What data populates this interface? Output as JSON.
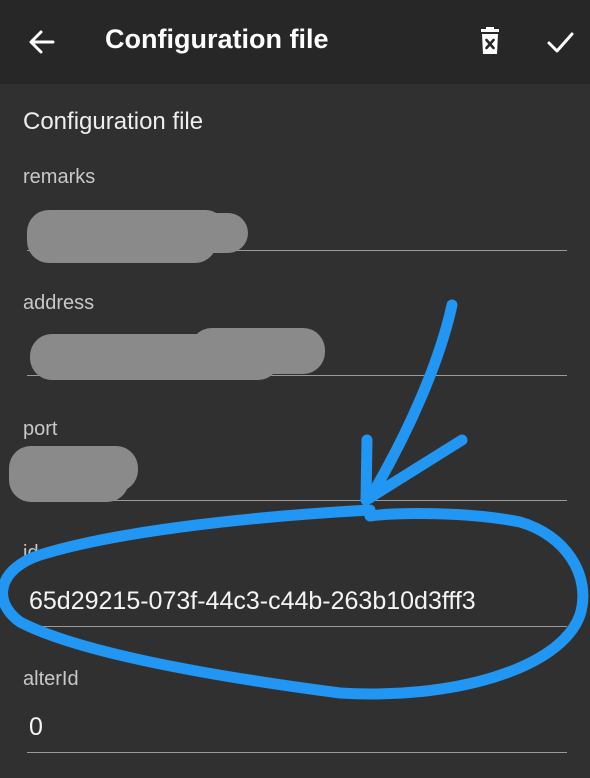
{
  "app_bar": {
    "title": "Configuration file",
    "back_icon": "arrow-left-icon",
    "delete_icon": "delete-icon",
    "confirm_icon": "check-icon"
  },
  "form": {
    "section_title": "Configuration file",
    "fields": {
      "remarks": {
        "label": "remarks",
        "value": ""
      },
      "address": {
        "label": "address",
        "value": ""
      },
      "port": {
        "label": "port",
        "value": ""
      },
      "id": {
        "label": "id",
        "value": "65d29215-073f-44c3-c44b-263b10d3fff3"
      },
      "alterId": {
        "label": "alterId",
        "value": "0"
      }
    }
  },
  "annotation": {
    "color": "#2196F3",
    "shapes": [
      "hand-drawn-arrow",
      "hand-drawn-circle"
    ]
  },
  "colors": {
    "background": "#303030",
    "app_bar": "#272727",
    "text": "#ffffff",
    "underline": "#9a9a9a",
    "redaction": "#8a8a8a"
  }
}
